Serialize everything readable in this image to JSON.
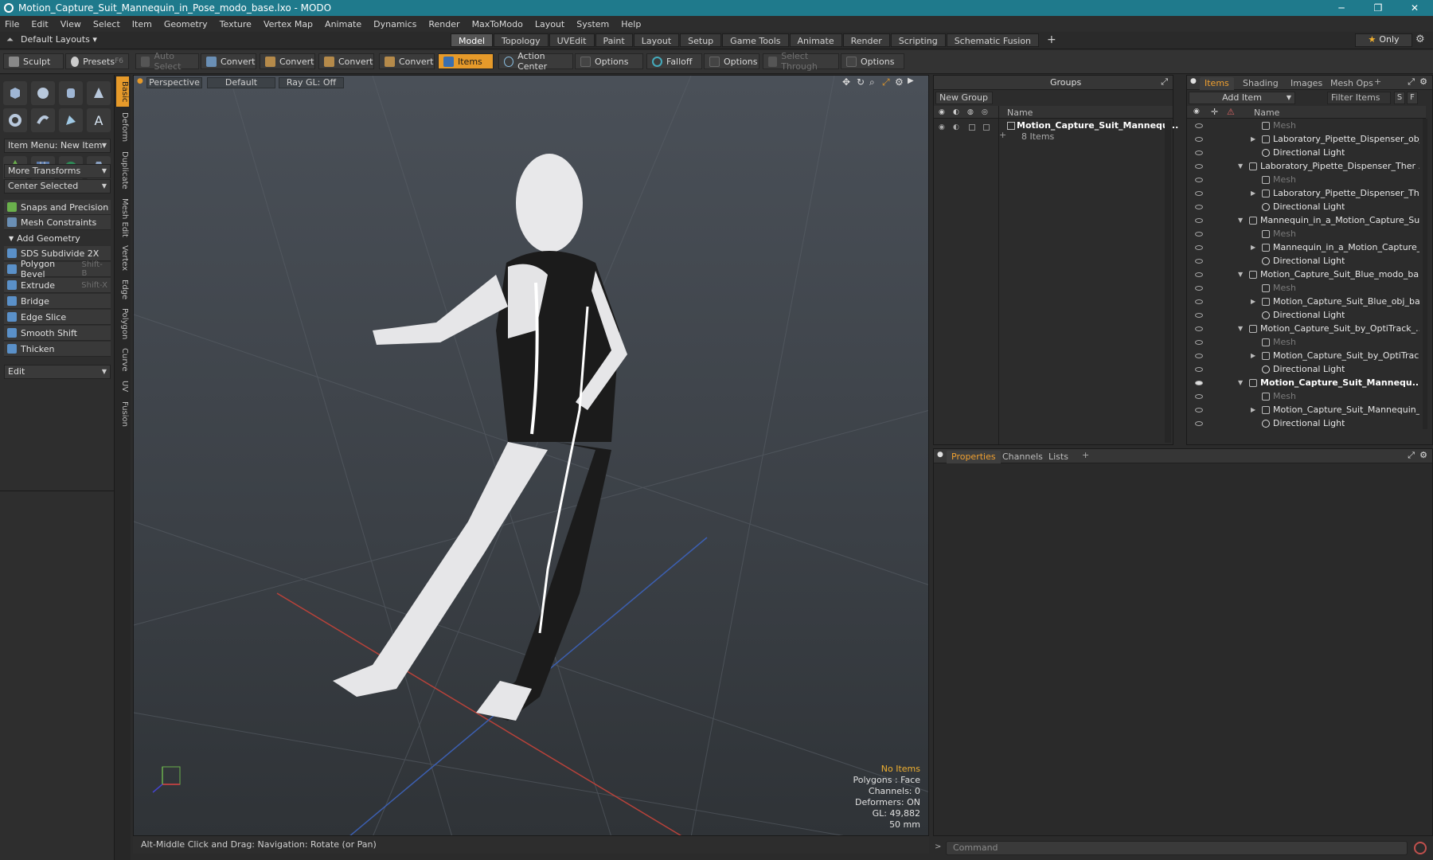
{
  "window": {
    "title": "Motion_Capture_Suit_Mannequin_in_Pose_modo_base.lxo - MODO",
    "minimize": "─",
    "maximize": "❐",
    "close": "✕"
  },
  "menu": [
    "File",
    "Edit",
    "View",
    "Select",
    "Item",
    "Geometry",
    "Texture",
    "Vertex Map",
    "Animate",
    "Dynamics",
    "Render",
    "MaxToModo",
    "Layout",
    "System",
    "Help"
  ],
  "layouts": {
    "dropdown": "Default Layouts",
    "tabs": [
      "Model",
      "Topology",
      "UVEdit",
      "Paint",
      "Layout",
      "Setup",
      "Game Tools",
      "Animate",
      "Render",
      "Scripting",
      "Schematic Fusion"
    ],
    "active_tab": "Model",
    "add": "+",
    "only": "Only"
  },
  "toolbar": {
    "sculpt": "Sculpt",
    "presets": "Presets",
    "presets_key": "F6",
    "auto_select": "Auto Select",
    "convert1": "Convert",
    "convert2": "Convert",
    "convert3": "Convert",
    "convert4": "Convert",
    "items": "Items",
    "action_center": "Action Center",
    "options1": "Options",
    "falloff": "Falloff",
    "options2": "Options",
    "select_through": "Select Through",
    "options3": "Options"
  },
  "leftpanel": {
    "item_menu": "Item Menu: New Item",
    "more_transforms": "More Transforms",
    "center_selected": "Center Selected",
    "snaps": "Snaps and Precision",
    "mesh_constraints": "Mesh Constraints",
    "add_geometry": "Add Geometry",
    "tools": [
      {
        "label": "SDS Subdivide 2X",
        "key": ""
      },
      {
        "label": "Polygon Bevel",
        "key": "Shift-B"
      },
      {
        "label": "Extrude",
        "key": "Shift-X"
      },
      {
        "label": "Bridge",
        "key": ""
      },
      {
        "label": "Edge Slice",
        "key": ""
      },
      {
        "label": "Smooth Shift",
        "key": ""
      },
      {
        "label": "Thicken",
        "key": ""
      }
    ],
    "edit": "Edit",
    "vtabs": [
      "Basic",
      "Deform",
      "Duplicate",
      "Mesh Edit",
      "Vertex",
      "Edge",
      "Polygon",
      "Curve",
      "UV",
      "Fusion"
    ]
  },
  "viewport": {
    "view": "Perspective",
    "shading": "Default",
    "raygl": "Ray GL: Off",
    "info": {
      "no_items": "No Items",
      "polygons": "Polygons : Face",
      "channels": "Channels: 0",
      "deformers": "Deformers: ON",
      "gl": "GL: 49,882",
      "focal": "50 mm"
    }
  },
  "groups": {
    "title": "Groups",
    "new_group": "New Group",
    "col_name": "Name",
    "group_name": "Motion_Capture_Suit_Mannequ...",
    "group_count": "8 Items"
  },
  "items_panel": {
    "tabs": [
      "Items",
      "Shading",
      "Images",
      "Mesh Ops"
    ],
    "add_item": "Add Item",
    "filter": "Filter Items",
    "col_name": "Name",
    "rows": [
      {
        "label": "Mesh",
        "indent": 2,
        "type": "mesh",
        "dim": true
      },
      {
        "label": "Laboratory_Pipette_Dispenser_obj...",
        "indent": 2,
        "type": "mesh",
        "tri": "right"
      },
      {
        "label": "Directional Light",
        "indent": 2,
        "type": "light"
      },
      {
        "label": "Laboratory_Pipette_Dispenser_Ther ...",
        "indent": 1,
        "type": "scene",
        "tri": "down"
      },
      {
        "label": "Mesh",
        "indent": 2,
        "type": "mesh",
        "dim": true
      },
      {
        "label": "Laboratory_Pipette_Dispenser_Th ...",
        "indent": 2,
        "type": "mesh",
        "tri": "right"
      },
      {
        "label": "Directional Light",
        "indent": 2,
        "type": "light"
      },
      {
        "label": "Mannequin_in_a_Motion_Capture_Su...",
        "indent": 1,
        "type": "scene",
        "tri": "down"
      },
      {
        "label": "Mesh",
        "indent": 2,
        "type": "mesh",
        "dim": true
      },
      {
        "label": "Mannequin_in_a_Motion_Capture_...",
        "indent": 2,
        "type": "mesh",
        "tri": "right"
      },
      {
        "label": "Directional Light",
        "indent": 2,
        "type": "light"
      },
      {
        "label": "Motion_Capture_Suit_Blue_modo_ba ...",
        "indent": 1,
        "type": "scene",
        "tri": "down"
      },
      {
        "label": "Mesh",
        "indent": 2,
        "type": "mesh",
        "dim": true
      },
      {
        "label": "Motion_Capture_Suit_Blue_obj_base",
        "indent": 2,
        "type": "mesh",
        "tri": "right"
      },
      {
        "label": "Directional Light",
        "indent": 2,
        "type": "light"
      },
      {
        "label": "Motion_Capture_Suit_by_OptiTrack_...",
        "indent": 1,
        "type": "scene",
        "tri": "down"
      },
      {
        "label": "Mesh",
        "indent": 2,
        "type": "mesh",
        "dim": true
      },
      {
        "label": "Motion_Capture_Suit_by_OptiTrac ...",
        "indent": 2,
        "type": "mesh",
        "tri": "right"
      },
      {
        "label": "Directional Light",
        "indent": 2,
        "type": "light"
      },
      {
        "label": "Motion_Capture_Suit_Mannequ...",
        "indent": 1,
        "type": "scene",
        "tri": "down",
        "bold": true
      },
      {
        "label": "Mesh",
        "indent": 2,
        "type": "mesh",
        "dim": true
      },
      {
        "label": "Motion_Capture_Suit_Mannequin_i...",
        "indent": 2,
        "type": "mesh",
        "tri": "right"
      },
      {
        "label": "Directional Light",
        "indent": 2,
        "type": "light"
      }
    ]
  },
  "properties": {
    "tabs": [
      "Properties",
      "Channels",
      "Lists"
    ],
    "add": "+"
  },
  "status": {
    "hint": "Alt-Middle Click and Drag:   Navigation: Rotate (or Pan)",
    "command_placeholder": "Command"
  },
  "colors": {
    "accent": "#e69a2a",
    "titlebar": "#1f7a8c"
  }
}
